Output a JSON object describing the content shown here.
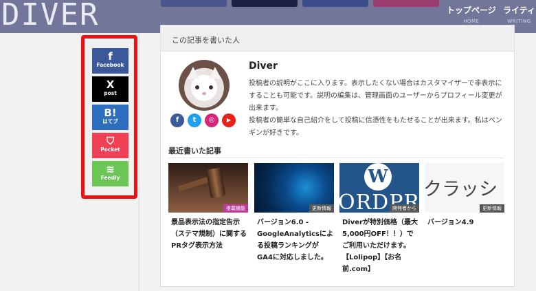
{
  "header": {
    "logo": "DIVER",
    "nav": [
      {
        "jp": "トップページ",
        "en": "HOME"
      },
      {
        "jp": "ライティ",
        "en": "WRITING"
      }
    ],
    "color": "#60658c"
  },
  "share": {
    "buttons": [
      {
        "label": "Facebook",
        "icon": "f",
        "icon_name": "facebook-icon",
        "color": "#3b5998"
      },
      {
        "label": "post",
        "icon": "X",
        "icon_name": "x-icon",
        "color": "#000000"
      },
      {
        "label": "はてブ",
        "icon": "B!",
        "icon_name": "hatena-icon",
        "color": "#2c6ebd"
      },
      {
        "label": "Pocket",
        "icon": "⛉",
        "icon_name": "pocket-icon",
        "color": "#ef4056"
      },
      {
        "label": "Feedly",
        "icon": "≋",
        "icon_name": "feedly-icon",
        "color": "#6cc655"
      }
    ],
    "border_color": "#ee1111"
  },
  "author_box": {
    "title": "この記事を書いた人",
    "name": "Diver",
    "description": "投稿者の説明がここに入ります。表示したくない場合はカスタマイザーで非表示にすることも可能です。説明の編集は、管理画面のユーザーからプロフィール変更が出来ます。\n投稿者の簡単な自己紹介をして投稿に信憑性をもたせることが出来ます。私はペンギンが好きです。",
    "social": [
      {
        "icon": "f",
        "icon_name": "facebook-icon",
        "color": "#3b5998"
      },
      {
        "icon": "t",
        "icon_name": "twitter-icon",
        "color": "#1da1f2"
      },
      {
        "icon": "◎",
        "icon_name": "instagram-icon",
        "color": "#d6247c"
      },
      {
        "icon": "▶",
        "icon_name": "youtube-icon",
        "color": "#e62117"
      }
    ]
  },
  "recent": {
    "title": "最近書いた記事",
    "posts": [
      {
        "title": "景品表示法の指定告示（ステマ規制）に関するPRタグ表示方法",
        "badge": "搭載機能",
        "badge_color": "#c0399f"
      },
      {
        "title": "バージョン6.0 - GoogleAnalyticsによる投稿ランキングがGA4に対応しました。",
        "badge": "更新情報",
        "badge_color": "#555555"
      },
      {
        "title": "Diverが特別価格（最大5,000円OFF！！）でご利用いただけます。【Lolipop】【お名前.com】",
        "badge": "開発者から",
        "badge_color": "#555555",
        "thumb_text": "ORDPRE"
      },
      {
        "title": "バージョン4.9",
        "badge": "更新情報",
        "badge_color": "#555555",
        "thumb_text": "クラッシ"
      }
    ]
  }
}
